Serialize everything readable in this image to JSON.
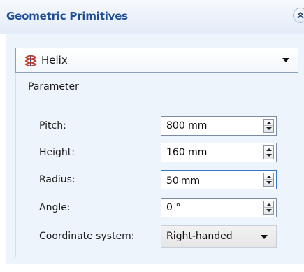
{
  "panel": {
    "title": "Geometric Primitives",
    "collapse_icon": "double-chevron-up-icon"
  },
  "primitive_select": {
    "icon": "helix-icon",
    "selected": "Helix"
  },
  "parameters": {
    "group_label": "Parameter",
    "pitch": {
      "label": "Pitch:",
      "value": "800 mm"
    },
    "height": {
      "label": "Height:",
      "value": "160 mm"
    },
    "radius": {
      "label": "Radius:",
      "value_before_caret": "50",
      "value_after_caret": "mm"
    },
    "angle": {
      "label": "Angle:",
      "value": "0 °"
    },
    "coordinate_system": {
      "label": "Coordinate system:",
      "selected": "Right-handed"
    }
  },
  "colors": {
    "title_text": "#1f4e96",
    "panel_background": "#eef4fc",
    "helix_icon": "#c0392b"
  }
}
